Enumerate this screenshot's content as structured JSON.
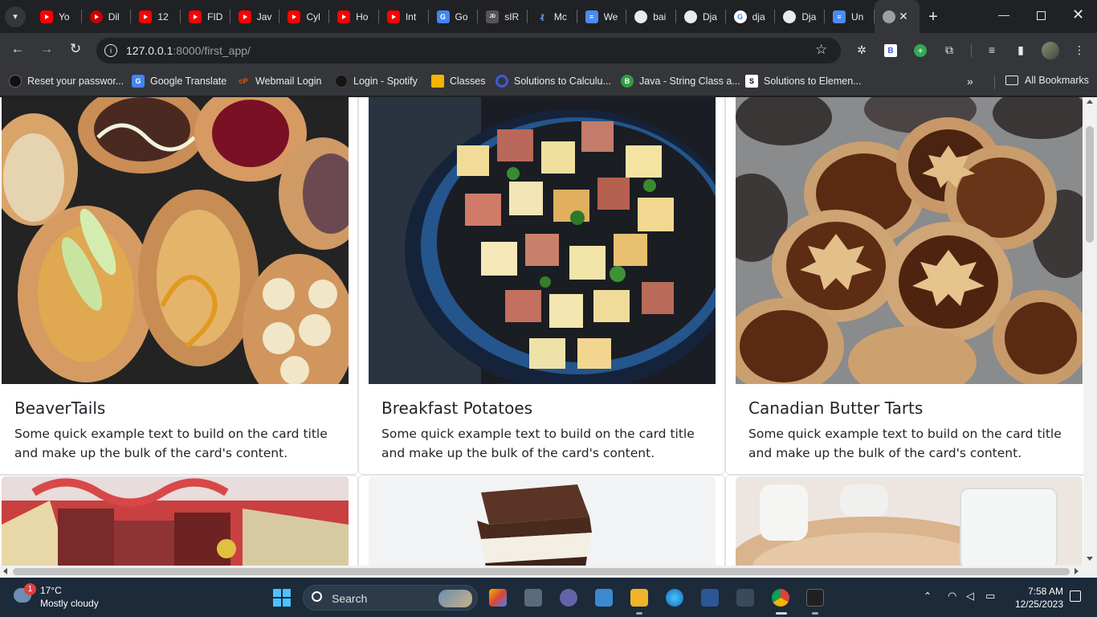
{
  "browser": {
    "tabs": [
      {
        "title": "Yo",
        "icon": "youtube-icon"
      },
      {
        "title": "Dil",
        "icon": "record-icon"
      },
      {
        "title": "12",
        "icon": "youtube-icon"
      },
      {
        "title": "FID",
        "icon": "youtube-icon"
      },
      {
        "title": "Jav",
        "icon": "youtube-icon"
      },
      {
        "title": "Cyl",
        "icon": "youtube-icon"
      },
      {
        "title": "Ho",
        "icon": "youtube-icon"
      },
      {
        "title": "Int",
        "icon": "youtube-icon"
      },
      {
        "title": "Go",
        "icon": "google-translate-icon"
      },
      {
        "title": "sIR",
        "icon": "jdoodle-icon"
      },
      {
        "title": "Mc",
        "icon": "mc-icon"
      },
      {
        "title": "We",
        "icon": "docs-icon"
      },
      {
        "title": "bai",
        "icon": "github-icon"
      },
      {
        "title": "Dja",
        "icon": "github-icon"
      },
      {
        "title": "dja",
        "icon": "google-icon"
      },
      {
        "title": "Dja",
        "icon": "github-icon"
      },
      {
        "title": "Un",
        "icon": "docs-icon"
      }
    ],
    "active_tab_icon": "globe-icon",
    "url_host": "127.0.0.1",
    "url_rest": ":8000/first_app/",
    "bookmarks": [
      {
        "label": "Reset your passwor...",
        "color": "#111111"
      },
      {
        "label": "Google Translate",
        "color": "#4285f4"
      },
      {
        "label": "Webmail Login",
        "color": "#e8590c"
      },
      {
        "label": "Login - Spotify",
        "color": "#191414"
      },
      {
        "label": "Classes",
        "color": "#f4b400"
      },
      {
        "label": "Solutions to Calculu...",
        "color": "#3b5bdb"
      },
      {
        "label": "Java - String Class a...",
        "color": "#2f9e44"
      },
      {
        "label": "Solutions to Elemen...",
        "color": "#000000"
      }
    ],
    "all_bookmarks": "All Bookmarks"
  },
  "cards": [
    {
      "title": "BeaverTails",
      "text": "Some quick example text to build on the card title and make up the bulk of the card's content."
    },
    {
      "title": "Breakfast Potatoes",
      "text": "Some quick example text to build on the card title and make up the bulk of the card's content."
    },
    {
      "title": "Canadian Butter Tarts",
      "text": "Some quick example text to build on the card title and make up the bulk of the card's content."
    }
  ],
  "taskbar": {
    "badge": "1",
    "temperature": "17°C",
    "condition": "Mostly cloudy",
    "search_label": "Search",
    "time": "7:58 AM",
    "date": "12/25/2023"
  }
}
